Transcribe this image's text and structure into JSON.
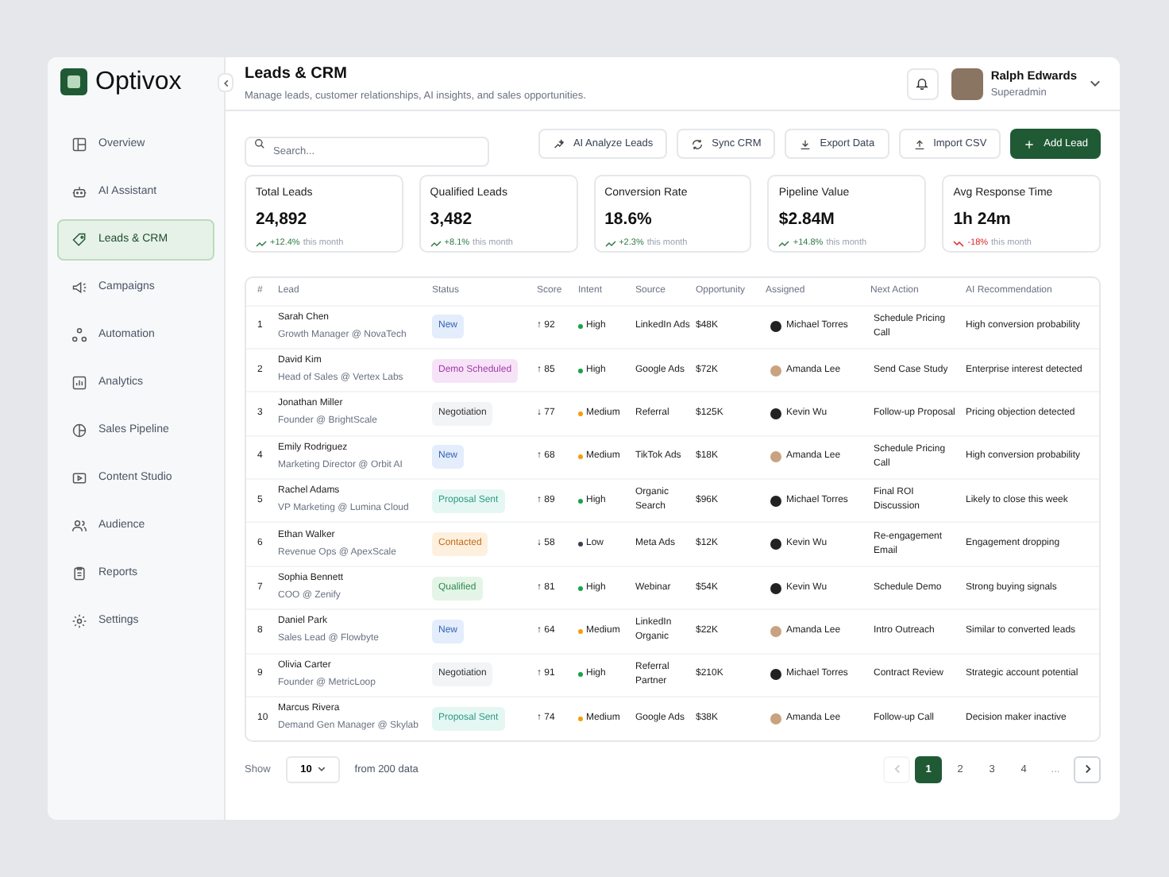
{
  "brand": "Optivox",
  "sidebar": {
    "items": [
      {
        "label": "Overview",
        "selected": false
      },
      {
        "label": "AI Assistant",
        "selected": false
      },
      {
        "label": "Leads & CRM",
        "selected": true
      },
      {
        "label": "Campaigns",
        "selected": false
      },
      {
        "label": "Automation",
        "selected": false
      },
      {
        "label": "Analytics",
        "selected": false
      },
      {
        "label": "Sales Pipeline",
        "selected": false
      },
      {
        "label": "Content Studio",
        "selected": false
      },
      {
        "label": "Audience",
        "selected": false
      },
      {
        "label": "Reports",
        "selected": false
      },
      {
        "label": "Settings",
        "selected": false
      }
    ]
  },
  "header": {
    "title": "Leads & CRM",
    "subtitle": "Manage leads, customer relationships, AI insights, and sales opportunities.",
    "user": {
      "name": "Ralph Edwards",
      "role": "Superadmin"
    }
  },
  "toolbar": {
    "search": {
      "placeholder": "Search..."
    },
    "buttons": [
      {
        "label": "AI Analyze Leads",
        "kind": "secondary"
      },
      {
        "label": "Sync CRM",
        "kind": "secondary"
      },
      {
        "label": "Export Data",
        "kind": "secondary"
      },
      {
        "label": "Import CSV",
        "kind": "secondary"
      },
      {
        "label": "Add Lead",
        "kind": "primary"
      }
    ]
  },
  "stats": [
    {
      "label": "Total Leads",
      "value": "24,892",
      "change": "+12.4%",
      "period": "this month",
      "kind": "up"
    },
    {
      "label": "Qualified Leads",
      "value": "3,482",
      "change": "+8.1%",
      "period": "this month",
      "kind": "up"
    },
    {
      "label": "Conversion Rate",
      "value": "18.6%",
      "change": "+2.3%",
      "period": "this month",
      "kind": "up"
    },
    {
      "label": "Pipeline Value",
      "value": "$2.84M",
      "change": "+14.8%",
      "period": "this month",
      "kind": "up"
    },
    {
      "label": "Avg Response Time",
      "value": "1h 24m",
      "change": "-18%",
      "period": "this month",
      "kind": "down"
    }
  ],
  "table": {
    "columns": [
      "#",
      "Lead",
      "Status",
      "Score",
      "Intent",
      "Source",
      "Opportunity",
      "Assigned",
      "Next Action",
      "AI Recommendation"
    ],
    "rows": [
      {
        "index": "1",
        "name": "Sarah Chen",
        "title": "Growth Manager @ NovaTech",
        "status": {
          "label": "New",
          "kind": "new"
        },
        "score": "↑ 92",
        "intent": {
          "label": "High",
          "color": "#16a34a"
        },
        "source": "LinkedIn Ads",
        "opportunity": "$48K",
        "assigned": "Michael Torres",
        "next_action": "Schedule Pricing Call",
        "recommendation": "High conversion probability"
      },
      {
        "index": "2",
        "name": "David Kim",
        "title": "Head of Sales @ Vertex Labs",
        "status": {
          "label": "Demo Scheduled",
          "kind": "demo"
        },
        "score": "↑ 85",
        "intent": {
          "label": "High",
          "color": "#16a34a"
        },
        "source": "Google Ads",
        "opportunity": "$72K",
        "assigned": "Amanda Lee",
        "next_action": "Send Case Study",
        "recommendation": "Enterprise interest detected"
      },
      {
        "index": "3",
        "name": "Jonathan Miller",
        "title": "Founder @ BrightScale",
        "status": {
          "label": "Negotiation",
          "kind": "negotiation"
        },
        "score": "↓ 77",
        "intent": {
          "label": "Medium",
          "color": "#f59e0b"
        },
        "source": "Referral",
        "opportunity": "$125K",
        "assigned": "Kevin Wu",
        "next_action": "Follow-up Proposal",
        "recommendation": "Pricing objection detected"
      },
      {
        "index": "4",
        "name": "Emily Rodriguez",
        "title": "Marketing Director @ Orbit AI",
        "status": {
          "label": "New",
          "kind": "new"
        },
        "score": "↑ 68",
        "intent": {
          "label": "Medium",
          "color": "#f59e0b"
        },
        "source": "TikTok Ads",
        "opportunity": "$18K",
        "assigned": "Amanda Lee",
        "next_action": "Schedule Pricing Call",
        "recommendation": "High conversion probability"
      },
      {
        "index": "5",
        "name": "Rachel Adams",
        "title": "VP Marketing @ Lumina Cloud",
        "status": {
          "label": "Proposal Sent",
          "kind": "proposal"
        },
        "score": "↑ 89",
        "intent": {
          "label": "High",
          "color": "#16a34a"
        },
        "source": "Organic Search",
        "opportunity": "$96K",
        "assigned": "Michael Torres",
        "next_action": "Final ROI Discussion",
        "recommendation": "Likely to close this week"
      },
      {
        "index": "6",
        "name": "Ethan Walker",
        "title": "Revenue Ops @ ApexScale",
        "status": {
          "label": "Contacted",
          "kind": "contacted"
        },
        "score": "↓ 58",
        "intent": {
          "label": "Low",
          "color": "#374151"
        },
        "source": "Meta Ads",
        "opportunity": "$12K",
        "assigned": "Kevin Wu",
        "next_action": "Re-engagement Email",
        "recommendation": "Engagement dropping"
      },
      {
        "index": "7",
        "name": "Sophia Bennett",
        "title": "COO @ Zenify",
        "status": {
          "label": "Qualified",
          "kind": "qualified"
        },
        "score": "↑ 81",
        "intent": {
          "label": "High",
          "color": "#16a34a"
        },
        "source": "Webinar",
        "opportunity": "$54K",
        "assigned": "Kevin Wu",
        "next_action": "Schedule Demo",
        "recommendation": "Strong buying signals"
      },
      {
        "index": "8",
        "name": "Daniel Park",
        "title": "Sales Lead @ Flowbyte",
        "status": {
          "label": "New",
          "kind": "new"
        },
        "score": "↑ 64",
        "intent": {
          "label": "Medium",
          "color": "#f59e0b"
        },
        "source": "LinkedIn Organic",
        "opportunity": "$22K",
        "assigned": "Amanda Lee",
        "next_action": "Intro Outreach",
        "recommendation": "Similar to converted leads"
      },
      {
        "index": "9",
        "name": "Olivia Carter",
        "title": "Founder @ MetricLoop",
        "status": {
          "label": "Negotiation",
          "kind": "negotiation"
        },
        "score": "↑ 91",
        "intent": {
          "label": "High",
          "color": "#16a34a"
        },
        "source": "Referral Partner",
        "opportunity": "$210K",
        "assigned": "Michael Torres",
        "next_action": "Contract Review",
        "recommendation": "Strategic account potential"
      },
      {
        "index": "10",
        "name": "Marcus Rivera",
        "title": "Demand Gen Manager @ Skylab",
        "status": {
          "label": "Proposal Sent",
          "kind": "proposal"
        },
        "score": "↑ 74",
        "intent": {
          "label": "Medium",
          "color": "#f59e0b"
        },
        "source": "Google Ads",
        "opportunity": "$38K",
        "assigned": "Amanda Lee",
        "next_action": "Follow-up Call",
        "recommendation": "Decision maker inactive"
      }
    ]
  },
  "pagination": {
    "show_label": "Show",
    "page_size": "10",
    "total": "from 200 data",
    "pages": [
      {
        "label": "1",
        "selected": true
      },
      {
        "label": "2",
        "selected": false
      },
      {
        "label": "3",
        "selected": false
      },
      {
        "label": "4",
        "selected": false
      }
    ],
    "ellipsis": "..."
  }
}
